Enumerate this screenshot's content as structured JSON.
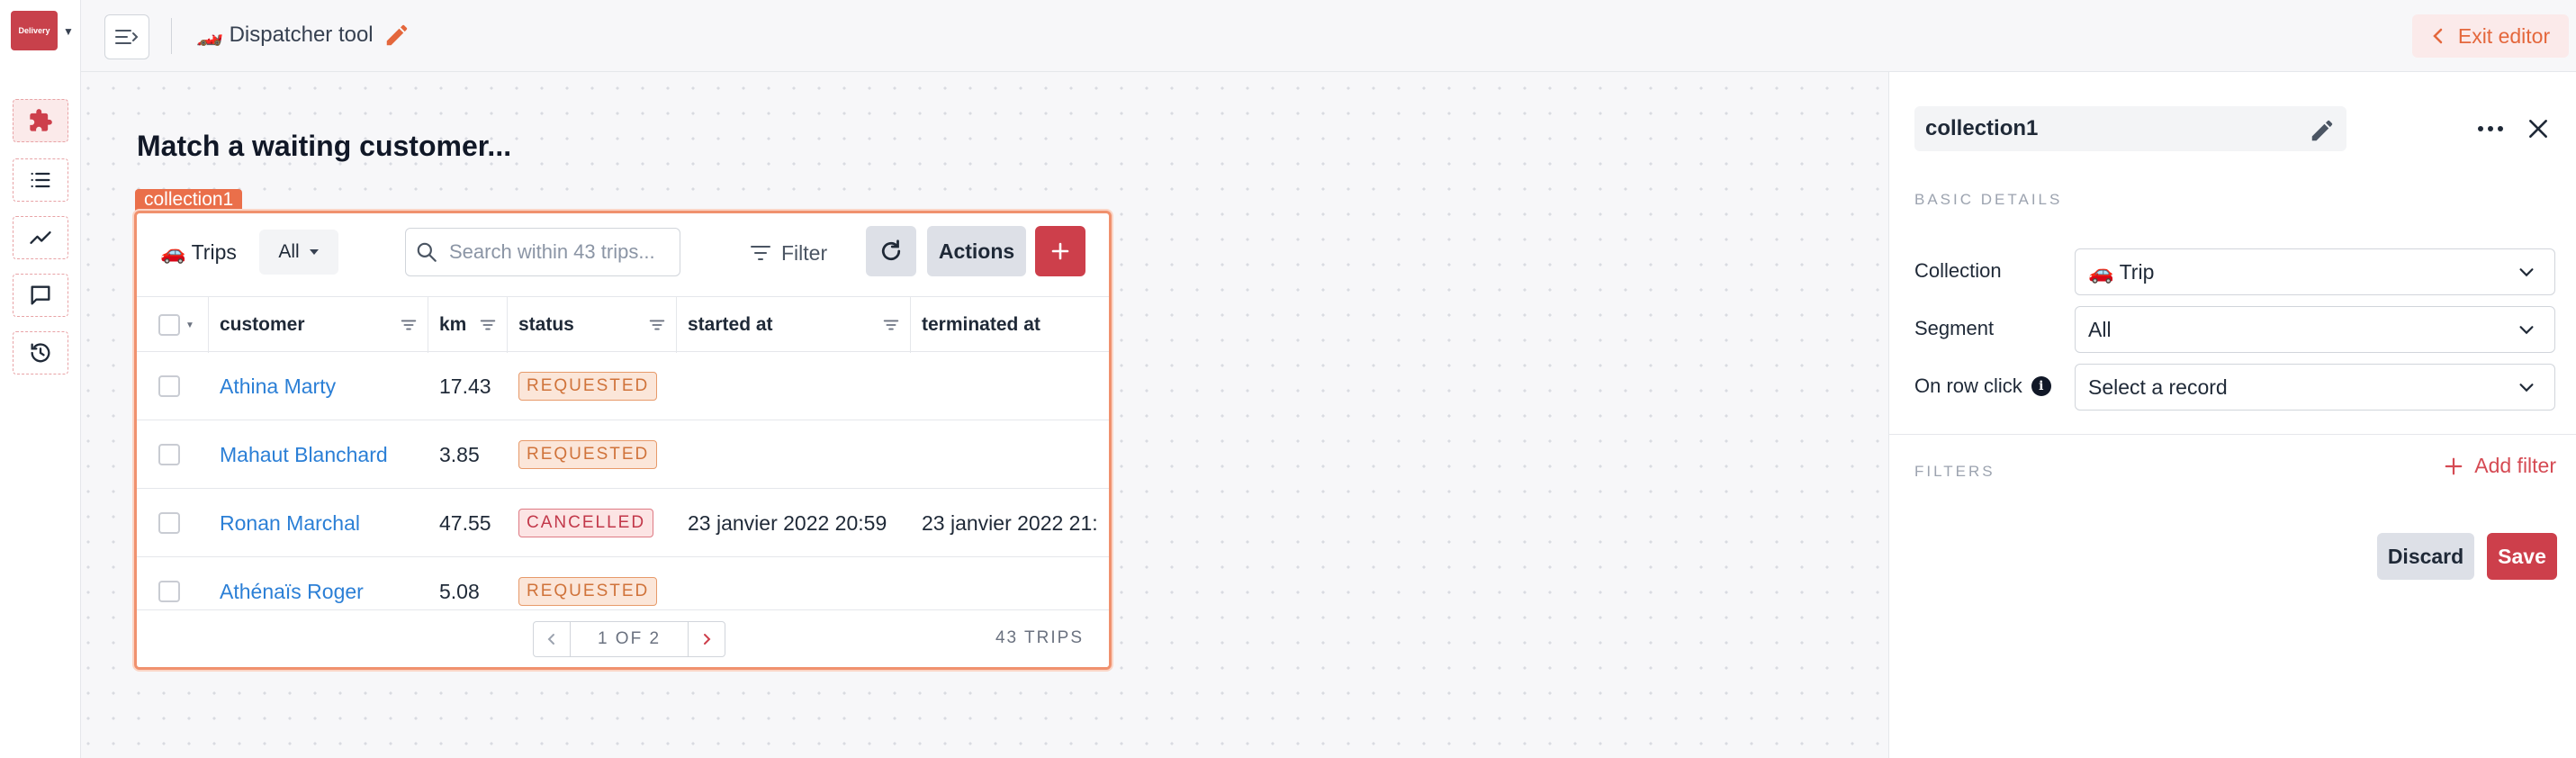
{
  "app": {
    "logo_text": "Delivery",
    "title": "Dispatcher tool",
    "title_emoji": "🏎️",
    "exit_label": "Exit editor"
  },
  "sidebar": {
    "items": [
      {
        "icon": "puzzle-icon",
        "active": true
      },
      {
        "icon": "list-icon",
        "active": false
      },
      {
        "icon": "chart-line-icon",
        "active": false
      },
      {
        "icon": "chat-icon",
        "active": false
      },
      {
        "icon": "history-icon",
        "active": false
      }
    ]
  },
  "canvas": {
    "heading": "Match a waiting customer...",
    "component_tag": "collection1"
  },
  "collection": {
    "trips_label": "🚗 Trips",
    "segment_value": "All",
    "search_placeholder": "Search within 43 trips...",
    "filter_label": "Filter",
    "actions_label": "Actions",
    "columns": [
      "customer",
      "km",
      "status",
      "started at",
      "terminated at"
    ],
    "rows": [
      {
        "customer": "Athina Marty",
        "km": "17.43",
        "status": "REQUESTED",
        "started_at": "",
        "terminated_at": ""
      },
      {
        "customer": "Mahaut Blanchard",
        "km": "3.85",
        "status": "REQUESTED",
        "started_at": "",
        "terminated_at": ""
      },
      {
        "customer": "Ronan Marchal",
        "km": "47.55",
        "status": "CANCELLED",
        "started_at": "23 janvier 2022 20:59",
        "terminated_at": "23 janvier 2022 21:"
      },
      {
        "customer": "Athénaïs Roger",
        "km": "5.08",
        "status": "REQUESTED",
        "started_at": "",
        "terminated_at": ""
      }
    ],
    "pagination": "1 OF 2",
    "total": "43 TRIPS"
  },
  "panel": {
    "component_name": "collection1",
    "basic_details_title": "BASIC DETAILS",
    "collection_label": "Collection",
    "collection_value": "🚗 Trip",
    "segment_label": "Segment",
    "segment_value": "All",
    "on_row_click_label": "On row click",
    "on_row_click_value": "Select a record",
    "filters_title": "FILTERS",
    "add_filter_label": "Add filter",
    "discard_label": "Discard",
    "save_label": "Save"
  },
  "colors": {
    "brand": "#cd3f4b",
    "accent_orange": "#ea6f4a",
    "link": "#2b7fd6"
  }
}
